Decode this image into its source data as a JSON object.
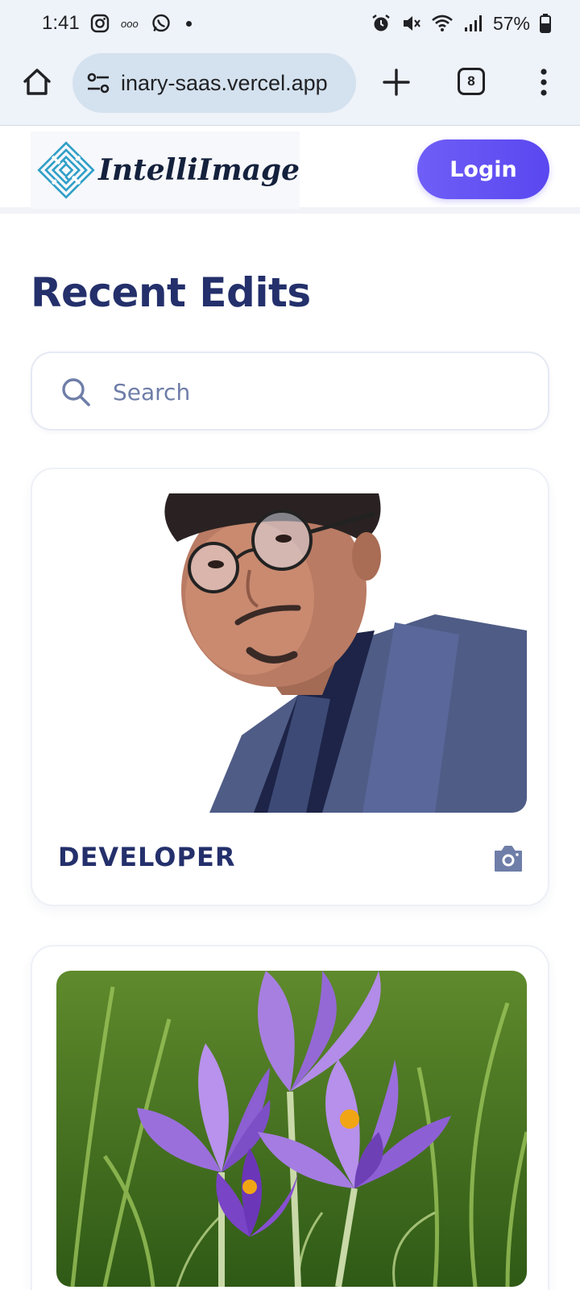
{
  "status_bar": {
    "time": "1:41",
    "battery": "57%",
    "icons": [
      "instagram-icon",
      "meta-icon",
      "whatsapp-icon",
      "notification-dot",
      "alarm-icon",
      "mute-icon",
      "wifi-icon",
      "signal-icon",
      "battery-icon"
    ]
  },
  "browser": {
    "url": "inary-saas.vercel.app",
    "tab_count": "8",
    "icons": [
      "home-icon",
      "site-info-icon",
      "plus-icon",
      "tabs-icon",
      "more-vert-icon"
    ]
  },
  "header": {
    "logo_text": "IntelliImage",
    "login_label": "Login"
  },
  "main": {
    "title": "Recent Edits",
    "search": {
      "placeholder": "Search",
      "value": ""
    },
    "cards": [
      {
        "title": "DEVELOPER",
        "transformation_icon": "camera-icon",
        "image": "portrait-photo"
      },
      {
        "title": "",
        "image": "crocus-flowers-photo"
      }
    ]
  },
  "colors": {
    "accent": "#5a47f0",
    "heading": "#24306b",
    "browser_chrome": "#eef2f9",
    "url_pill": "#d4e1ee",
    "muted_icon": "#6f7ea8"
  }
}
